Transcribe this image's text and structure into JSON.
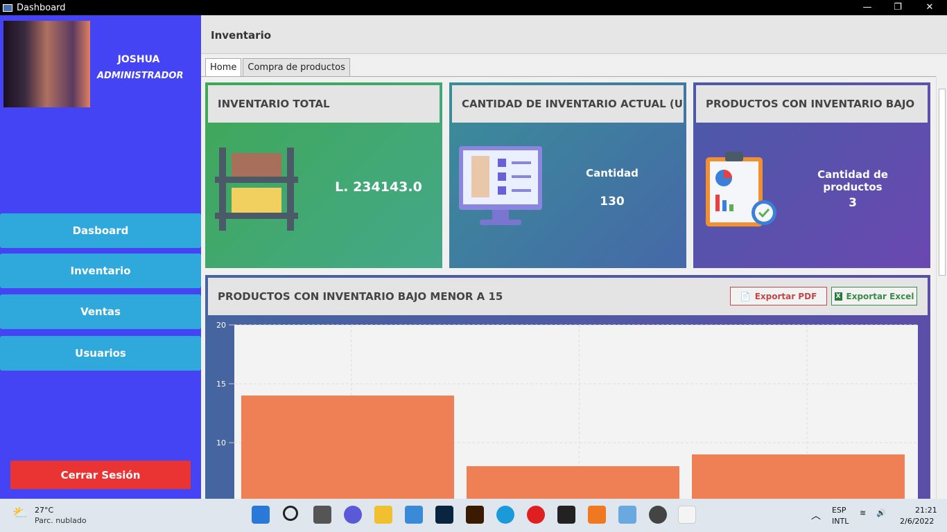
{
  "window": {
    "title": "Dashboard",
    "minimize": "—",
    "restore": "❐",
    "close": "✕"
  },
  "user": {
    "name": "JOSHUA",
    "role": "ADMINISTRADOR"
  },
  "nav": [
    {
      "label": "Dasboard"
    },
    {
      "label": "Inventario"
    },
    {
      "label": "Ventas"
    },
    {
      "label": "Usuarios"
    }
  ],
  "logout": "Cerrar Sesión",
  "header": {
    "title": "Inventario"
  },
  "tabs": [
    {
      "label": "Home"
    },
    {
      "label": "Compra de productos"
    }
  ],
  "cards": [
    {
      "title": "INVENTARIO TOTAL",
      "value": "L. 234143.0"
    },
    {
      "title": "CANTIDAD DE INVENTARIO ACTUAL (U...",
      "label": "Cantidad",
      "value": "130"
    },
    {
      "title": "PRODUCTOS CON INVENTARIO BAJO",
      "label": "Cantidad de productos",
      "value": "3"
    }
  ],
  "chart_panel": {
    "title": "PRODUCTOS CON  INVENTARIO BAJO MENOR A 15",
    "export_pdf": "Exportar PDF",
    "export_excel": "Exportar Excel"
  },
  "chart_data": {
    "type": "bar",
    "categories": [
      "",
      "",
      ""
    ],
    "values": [
      14,
      8,
      9
    ],
    "yticks": [
      "10",
      "15",
      "20"
    ],
    "ylim": [
      0,
      20
    ],
    "grid": true,
    "color": "#ef7f55"
  },
  "taskbar": {
    "temp": "27°C",
    "weather": "Parc. nublado",
    "lang1": "ESP",
    "lang2": "INTL",
    "time": "21:21",
    "date": "2/6/2022"
  }
}
